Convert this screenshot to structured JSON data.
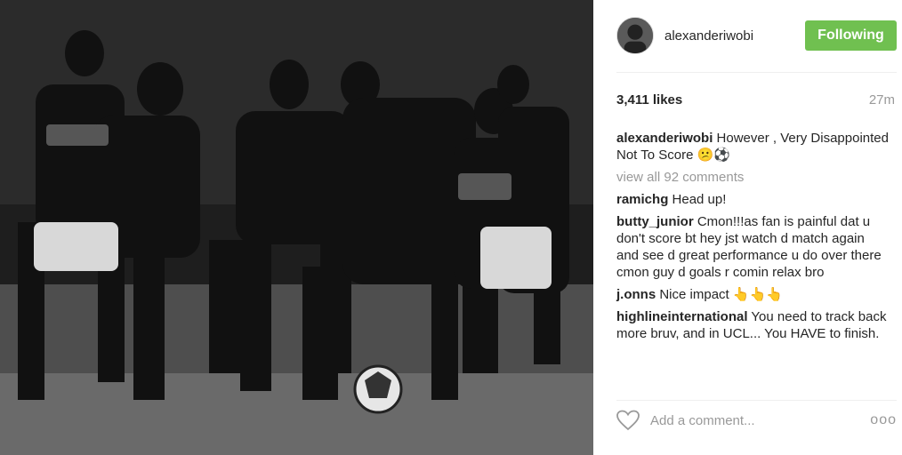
{
  "post": {
    "username": "alexanderiwobi",
    "follow_label": "Following",
    "likes": "3,411 likes",
    "time": "27m",
    "caption": {
      "user": "alexanderiwobi",
      "text": "However , Very Disappointed Not To Score 😕⚽"
    },
    "view_all": "view all 92 comments",
    "comments": [
      {
        "user": "ramichg",
        "text": "Head up!"
      },
      {
        "user": "butty_junior",
        "text": "Cmon!!!as fan is painful dat u don't score bt hey jst watch d match again and see d great performance u do over there cmon guy d goals r comin relax bro"
      },
      {
        "user": "j.onns",
        "text": "Nice impact 👆👆👆"
      },
      {
        "user": "highlineinternational",
        "text": "You need to track back more bruv, and in UCL... You HAVE to finish."
      }
    ],
    "add_comment_placeholder": "Add a comment...",
    "more_label": "ooo"
  },
  "colors": {
    "follow_button": "#70c050",
    "muted_text": "#999999"
  },
  "icons": [
    "heart-icon",
    "more-options-icon"
  ]
}
